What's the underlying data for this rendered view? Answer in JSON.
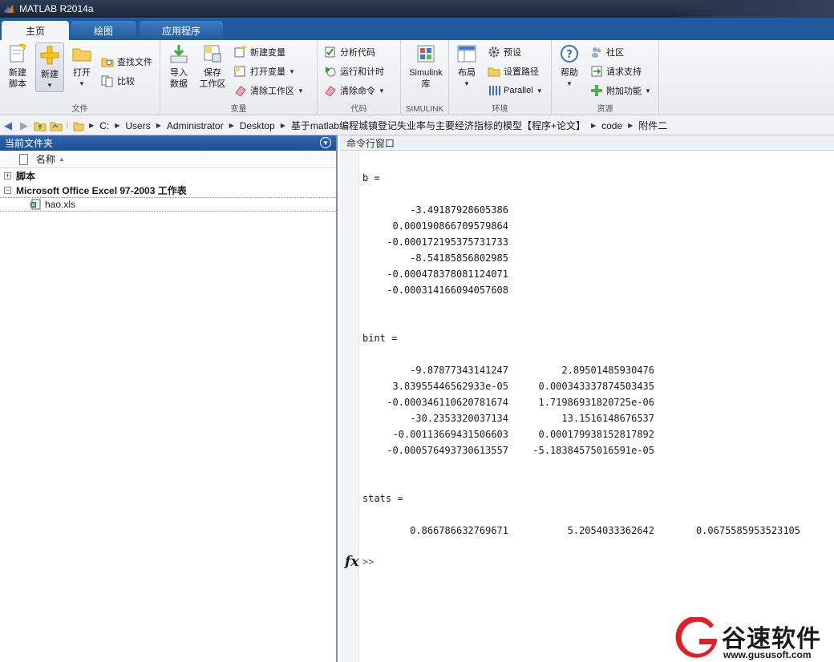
{
  "window": {
    "title": "MATLAB R2014a"
  },
  "tabs": [
    {
      "label": "主页",
      "active": true
    },
    {
      "label": "绘图",
      "active": false
    },
    {
      "label": "应用程序",
      "active": false
    }
  ],
  "ribbon": {
    "file": {
      "label": "文件",
      "new_script": "新建\n脚本",
      "new": "新建",
      "open": "打开",
      "find_files": "查找文件",
      "compare": "比较"
    },
    "variable": {
      "label": "变量",
      "import_data": "导入\n数据",
      "save_workspace": "保存\n工作区",
      "new_variable": "新建变量",
      "open_variable": "打开变量",
      "clear_workspace": "清除工作区"
    },
    "code": {
      "label": "代码",
      "analyze_code": "分析代码",
      "run_and_time": "运行和计时",
      "clear_commands": "清除命令"
    },
    "simulink": {
      "label": "SIMULINK",
      "library": "Simulink\n库"
    },
    "environment": {
      "label": "环境",
      "layout": "布局",
      "preferences": "预设",
      "set_path": "设置路径",
      "parallel": "Parallel"
    },
    "resources": {
      "label": "资源",
      "help": "帮助",
      "community": "社区",
      "request_support": "请求支持",
      "add_ons": "附加功能"
    }
  },
  "address": {
    "crumbs": [
      "C:",
      "Users",
      "Administrator",
      "Desktop",
      "基于matlab编程城镇登记失业率与主要经济指标的模型【程序+论文】",
      "code",
      "附件二"
    ]
  },
  "current_folder": {
    "title": "当前文件夹",
    "column_name": "名称",
    "group_scripts": "脚本",
    "group_excel": "Microsoft Office Excel 97-2003 工作表",
    "file": "hao.xls"
  },
  "command_window": {
    "title": "命令行窗口",
    "b_label": "b =",
    "b_values": [
      "-3.49187928605386",
      "0.000190866709579864",
      "-0.000172195375731733",
      "-8.54185856802985",
      "-0.000478378081124071",
      "-0.000314166094057608"
    ],
    "bint_label": "bint =",
    "bint_col1": [
      "-9.87877343141247",
      "3.83955446562933e-05",
      "-0.000346110620781674",
      "-30.2353320037134",
      "-0.00113669431506603",
      "-0.000576493730613557"
    ],
    "bint_col2": [
      "2.89501485930476",
      "0.000343337874503435",
      "1.71986931820725e-06",
      "13.1516148676537",
      "0.000179938152817892",
      "-5.18384575016591e-05"
    ],
    "stats_label": "stats =",
    "stats_values": [
      "0.866786632769671",
      "5.2054033362642",
      "0.0675585953523105"
    ],
    "fx": "fx",
    "prompt": ">>"
  },
  "watermark": {
    "text": "谷速软件",
    "url": "www.gususoft.com"
  }
}
